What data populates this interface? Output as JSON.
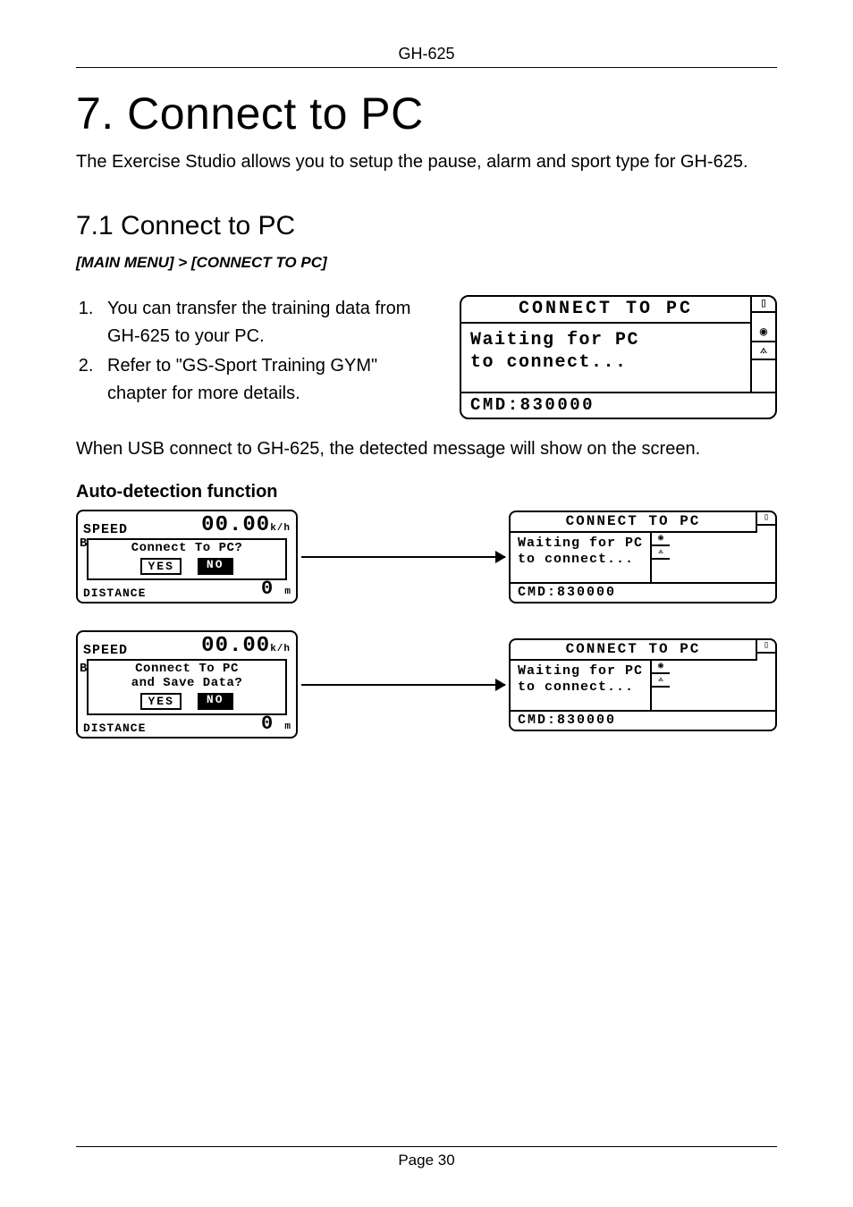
{
  "header": {
    "product": "GH-625"
  },
  "chapter": {
    "title": "7. Connect to PC"
  },
  "lead": "The Exercise Studio allows you to setup the pause, alarm and sport type for GH-625.",
  "section": {
    "title": "7.1 Connect to PC"
  },
  "menu_path": "[MAIN MENU] > [CONNECT TO PC]",
  "steps": [
    "You can transfer the training data from GH-625 to your PC.",
    "Refer to \"GS-Sport Training GYM\" chapter for more details."
  ],
  "note": "When USB connect to GH-625, the detected message will show on the screen.",
  "subheading": "Auto-detection function",
  "lcd": {
    "title": "CONNECT TO PC",
    "line1": "Waiting for PC",
    "line2": "to connect...",
    "cmd": "CMD:830000"
  },
  "prompt1": {
    "speed_label": "SPEED",
    "speed_value": "00.00",
    "speed_unit": "k/h",
    "question": "Connect To PC?",
    "yes": "YES",
    "no": "NO",
    "dist_label": "DISTANCE",
    "dist_value": "0",
    "dist_unit": "m",
    "left_marker": "B"
  },
  "prompt2": {
    "speed_label": "SPEED",
    "speed_value": "00.00",
    "speed_unit": "k/h",
    "q_line1": "Connect To PC",
    "q_line2": "and Save Data?",
    "yes": "YES",
    "no": "NO",
    "dist_label": "DISTANCE",
    "dist_value": "0",
    "dist_unit": "m",
    "left_marker": "B"
  },
  "footer": {
    "page": "Page 30"
  }
}
